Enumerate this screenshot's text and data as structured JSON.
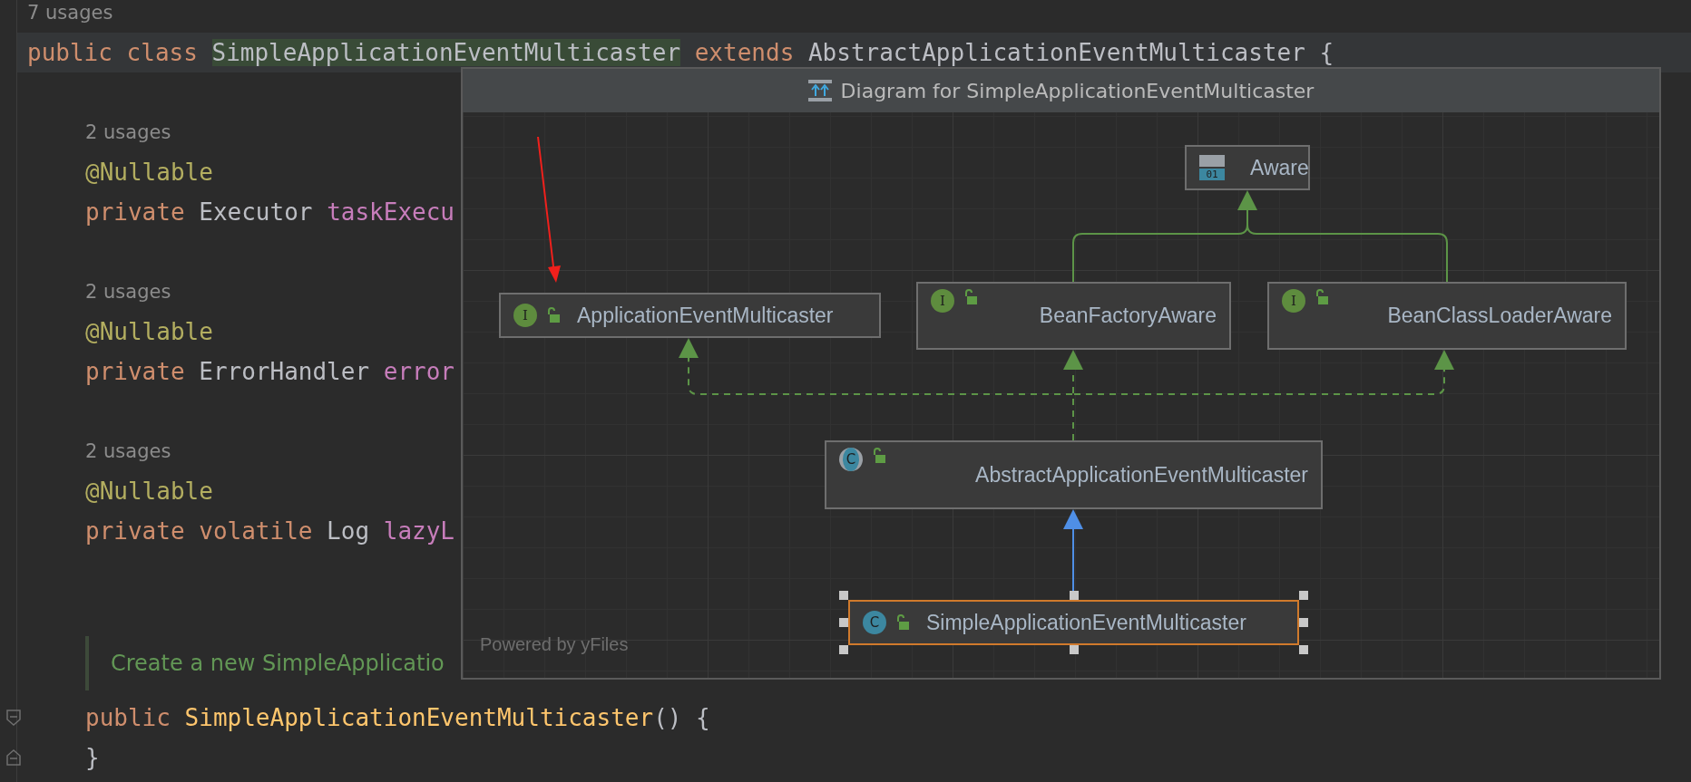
{
  "editor": {
    "lines": [
      {
        "kind": "hint",
        "indented": false,
        "text": "7 usages"
      },
      {
        "kind": "code",
        "indented": false,
        "current": true,
        "tokens": [
          {
            "kind": "keyword",
            "t": "public class "
          },
          {
            "kind": "type",
            "t": "SimpleApplicationEventMulticaster",
            "highlighted": true
          },
          {
            "kind": "keyword",
            "t": " extends "
          },
          {
            "kind": "type",
            "t": "AbstractApplicationEventMulticaster "
          },
          {
            "kind": "plain",
            "t": "{"
          }
        ]
      },
      {
        "kind": "blank"
      },
      {
        "kind": "hint",
        "indented": true,
        "text": "2 usages"
      },
      {
        "kind": "code",
        "indented": true,
        "tokens": [
          {
            "kind": "annotation",
            "t": "@Nullable"
          }
        ]
      },
      {
        "kind": "code",
        "indented": true,
        "tokens": [
          {
            "kind": "keyword",
            "t": "private "
          },
          {
            "kind": "type",
            "t": "Executor "
          },
          {
            "kind": "field",
            "t": "taskExecu"
          }
        ]
      },
      {
        "kind": "blank"
      },
      {
        "kind": "hint",
        "indented": true,
        "text": "2 usages"
      },
      {
        "kind": "code",
        "indented": true,
        "tokens": [
          {
            "kind": "annotation",
            "t": "@Nullable"
          }
        ]
      },
      {
        "kind": "code",
        "indented": true,
        "tokens": [
          {
            "kind": "keyword",
            "t": "private "
          },
          {
            "kind": "type",
            "t": "ErrorHandler "
          },
          {
            "kind": "field",
            "t": "error"
          }
        ]
      },
      {
        "kind": "blank"
      },
      {
        "kind": "hint",
        "indented": true,
        "text": "2 usages"
      },
      {
        "kind": "code",
        "indented": true,
        "tokens": [
          {
            "kind": "annotation",
            "t": "@Nullable"
          }
        ]
      },
      {
        "kind": "code",
        "indented": true,
        "tokens": [
          {
            "kind": "keyword",
            "t": "private volatile "
          },
          {
            "kind": "type",
            "t": "Log "
          },
          {
            "kind": "field",
            "t": "lazyL"
          }
        ]
      },
      {
        "kind": "blank"
      },
      {
        "kind": "doc",
        "indented": true,
        "text": "Create a new SimpleApplicatio"
      },
      {
        "kind": "code",
        "indented": true,
        "fold_start": true,
        "tokens": [
          {
            "kind": "keyword",
            "t": "public "
          },
          {
            "kind": "method",
            "t": "SimpleApplicationEventMulticaster"
          },
          {
            "kind": "plain",
            "t": "() {"
          }
        ]
      },
      {
        "kind": "code",
        "indented": true,
        "fold_end": true,
        "tokens": [
          {
            "kind": "plain",
            "t": "}"
          }
        ]
      }
    ]
  },
  "diagram_popup": {
    "title": "Diagram for SimpleApplicationEventMulticaster",
    "nodes": [
      {
        "kind": "marker",
        "badge": "01",
        "name": "Aware",
        "selected": false
      },
      {
        "kind": "interface",
        "badge": "I",
        "name": "ApplicationEventMulticaster",
        "selected": false
      },
      {
        "kind": "interface",
        "badge": "I",
        "name": "BeanFactoryAware",
        "selected": false
      },
      {
        "kind": "interface",
        "badge": "I",
        "name": "BeanClassLoaderAware",
        "selected": false
      },
      {
        "kind": "abstract",
        "badge": "C",
        "name": "AbstractApplicationEventMulticaster",
        "selected": false
      },
      {
        "kind": "class",
        "badge": "C",
        "name": "SimpleApplicationEventMulticaster",
        "selected": true
      }
    ],
    "footer": "Powered by yFiles"
  }
}
